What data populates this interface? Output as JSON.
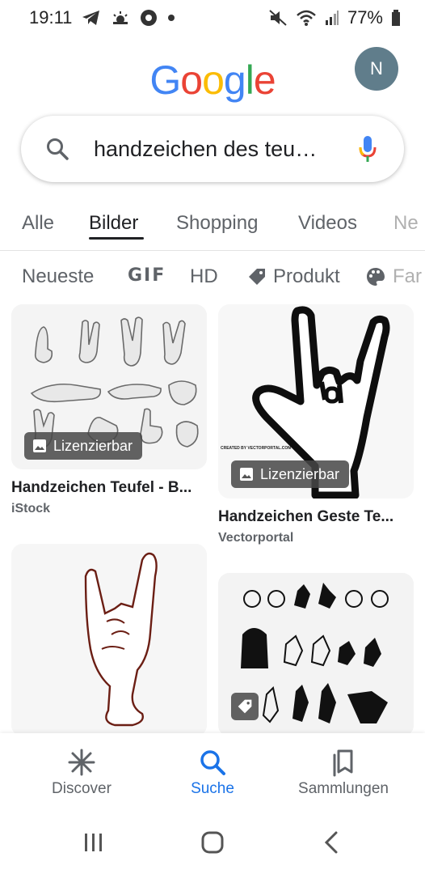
{
  "status_bar": {
    "time": "19:11",
    "battery": "77%",
    "icons": [
      "telegram-icon",
      "weather-icon",
      "chrome-icon",
      "dot-icon",
      "mute-icon",
      "wifi-icon",
      "signal-icon",
      "battery-icon"
    ]
  },
  "header": {
    "logo_letters": [
      "G",
      "o",
      "o",
      "g",
      "l",
      "e"
    ],
    "logo_colors": [
      "#4285F4",
      "#EA4335",
      "#FBBC05",
      "#4285F4",
      "#34A853",
      "#EA4335"
    ],
    "avatar_initial": "N"
  },
  "search": {
    "query": "handzeichen des teu…",
    "icon": "search-icon",
    "voice_icon": "mic-icon"
  },
  "tabs": [
    {
      "label": "Alle"
    },
    {
      "label": "Bilder",
      "active": true
    },
    {
      "label": "Shopping"
    },
    {
      "label": "Videos"
    },
    {
      "label": "Ne"
    }
  ],
  "filters": [
    {
      "label": "Neueste"
    },
    {
      "label": "GIF"
    },
    {
      "label": "HD"
    },
    {
      "label": "Produkt",
      "icon": "tag-icon"
    },
    {
      "label": "Far",
      "icon": "palette-icon"
    }
  ],
  "results": [
    {
      "title": "Handzeichen Teufel - B...",
      "source": "iStock",
      "badge": "Lizenzierbar"
    },
    {
      "title": "Handzeichen Geste Te...",
      "source": "Vectorportal",
      "badge": "Lizenzierbar",
      "image_text": "CREATED BY VECTORPORTAL.COM"
    },
    {
      "title": "",
      "source": ""
    },
    {
      "title": "",
      "source": "",
      "badge_icon": "tag-icon"
    }
  ],
  "bottom_nav": [
    {
      "label": "Discover",
      "icon": "asterisk-icon"
    },
    {
      "label": "Suche",
      "icon": "search-icon",
      "active": true
    },
    {
      "label": "Sammlungen",
      "icon": "collections-icon"
    }
  ],
  "colors": {
    "accent": "#1a73e8",
    "text": "#202124",
    "muted": "#5f6368"
  }
}
